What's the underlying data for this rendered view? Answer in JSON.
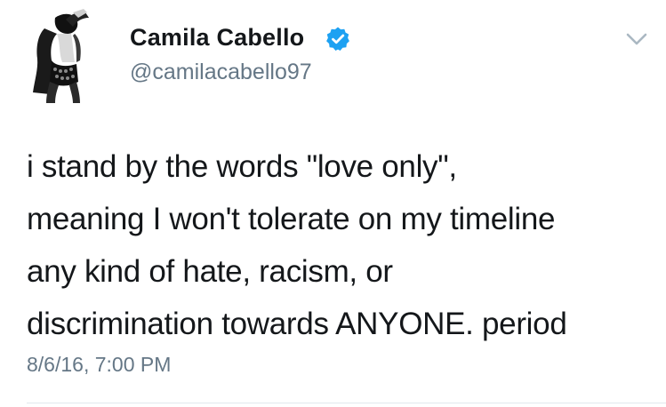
{
  "user": {
    "display_name": "Camila Cabello",
    "handle": "@camilacabello97",
    "verified": true,
    "avatar_icon": "profile-photo-icon"
  },
  "tweet": {
    "text": "i stand by the words \"love only\",\nmeaning I won't tolerate on my timeline\nany kind of hate, racism, or\ndiscrimination towards ANYONE. period",
    "timestamp": "8/6/16, 7:00 PM"
  },
  "colors": {
    "text": "#14171a",
    "secondary_text": "#657786",
    "verified_blue": "#1da1f2",
    "divider": "#e1e8ed",
    "caret": "#aab8c2"
  },
  "icons": {
    "verified": "verified-badge-icon",
    "more": "chevron-down-icon"
  }
}
